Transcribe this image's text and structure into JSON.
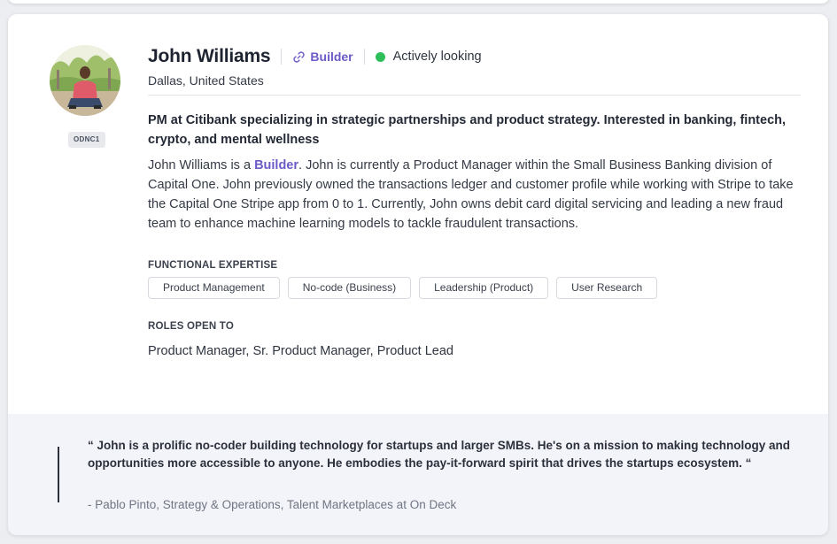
{
  "profile": {
    "name": "John Williams",
    "type_label": "Builder",
    "status": "Actively looking",
    "location": "Dallas, United States",
    "id_code": "ODNC1",
    "headline": "PM at Citibank specializing in strategic partnerships and product strategy. Interested in banking, fintech, crypto, and mental wellness",
    "bio_prefix": "John Williams is a ",
    "bio_accent": "Builder",
    "bio_rest": ". John is currently a Product Manager within the Small Business Banking division of Capital One. John previously owned the transactions ledger and customer profile while working with Stripe to take the Capital One Stripe app from 0 to 1. Currently, John owns debit card digital servicing and leading a new fraud team to enhance machine learning models to tackle fraudulent transactions."
  },
  "expertise": {
    "label": "FUNCTIONAL EXPERTISE",
    "chips": [
      "Product Management",
      "No-code (Business)",
      "Leadership (Product)",
      "User Research"
    ]
  },
  "roles": {
    "label": "ROLES OPEN TO",
    "value": "Product Manager, Sr. Product Manager, Product Lead"
  },
  "quote": {
    "text": "“ John is a prolific no-coder building technology for startups and larger SMBs. He's on a mission to making technology and opportunities more accessible to anyone. He embodies the pay-it-forward spirit that drives the startups ecosystem. “",
    "attribution": "- Pablo Pinto, Strategy & Operations, Talent Marketplaces at On Deck"
  },
  "icons": {
    "type_tag": "link-icon",
    "status": "status-dot-icon"
  },
  "colors": {
    "accent": "#6b5bc9",
    "status_green": "#2fbf5a",
    "quote_bg": "#f3f4fa"
  }
}
